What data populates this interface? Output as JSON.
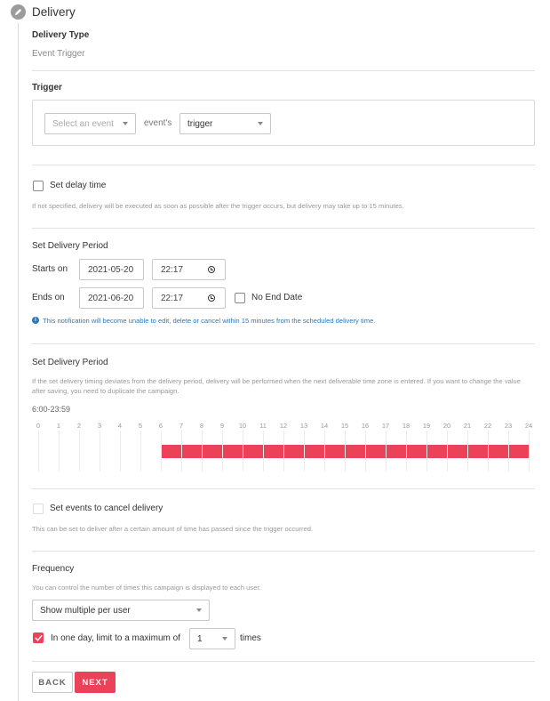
{
  "step": {
    "title": "Delivery",
    "icon": "pencil-icon"
  },
  "delivery_type": {
    "label": "Delivery Type",
    "value": "Event Trigger"
  },
  "trigger": {
    "label": "Trigger",
    "event_select_placeholder": "Select an event",
    "connector_text": "event's",
    "property_select_value": "trigger"
  },
  "delay": {
    "checkbox_label": "Set delay time",
    "checked": false,
    "help": "If not specified, delivery will be executed as soon as possible after the trigger occurs, but delivery may take up to 15 minutes."
  },
  "period": {
    "label": "Set Delivery Period",
    "starts_label": "Starts on",
    "start_date": "2021-05-20",
    "start_time": "22:17",
    "ends_label": "Ends on",
    "end_date": "2021-06-20",
    "end_time": "22:17",
    "no_end_date_label": "No End Date",
    "no_end_date_checked": false,
    "info_icon": "info-icon",
    "info_text": "This notification will become unable to edit, delete or cancel within 15 minutes from the scheduled delivery time.",
    "info_color": "#2f79b5"
  },
  "time_window": {
    "label": "Set Delivery Period",
    "help": "If the set delivery timing deviates from the delivery period, delivery will be performed when the next deliverable time zone is entered. If you want to change the value after saving, you need to duplicate the campaign.",
    "range_text": "6:00-23:59",
    "hour_labels": [
      "0",
      "1",
      "2",
      "3",
      "4",
      "5",
      "6",
      "7",
      "8",
      "9",
      "10",
      "11",
      "12",
      "13",
      "14",
      "15",
      "16",
      "17",
      "18",
      "19",
      "20",
      "21",
      "22",
      "23",
      "24"
    ],
    "selected_hours": [
      6,
      7,
      8,
      9,
      10,
      11,
      12,
      13,
      14,
      15,
      16,
      17,
      18,
      19,
      20,
      21,
      22,
      23
    ],
    "selected_color": "#ec4259"
  },
  "cancel_events": {
    "checkbox_label": "Set events to cancel delivery",
    "checked": false,
    "help": "This can be set to deliver after a certain amount of time has passed since the trigger occurred."
  },
  "frequency": {
    "label": "Frequency",
    "help": "You can control the number of times this campaign is displayed to each user.",
    "mode_value": "Show multiple per user",
    "limit_checked": true,
    "limit_label": "In one day, limit to a maximum of",
    "limit_value": "1",
    "limit_suffix": "times"
  },
  "actions": {
    "back_label": "BACK",
    "next_label": "NEXT",
    "accent": "#ec4259"
  }
}
